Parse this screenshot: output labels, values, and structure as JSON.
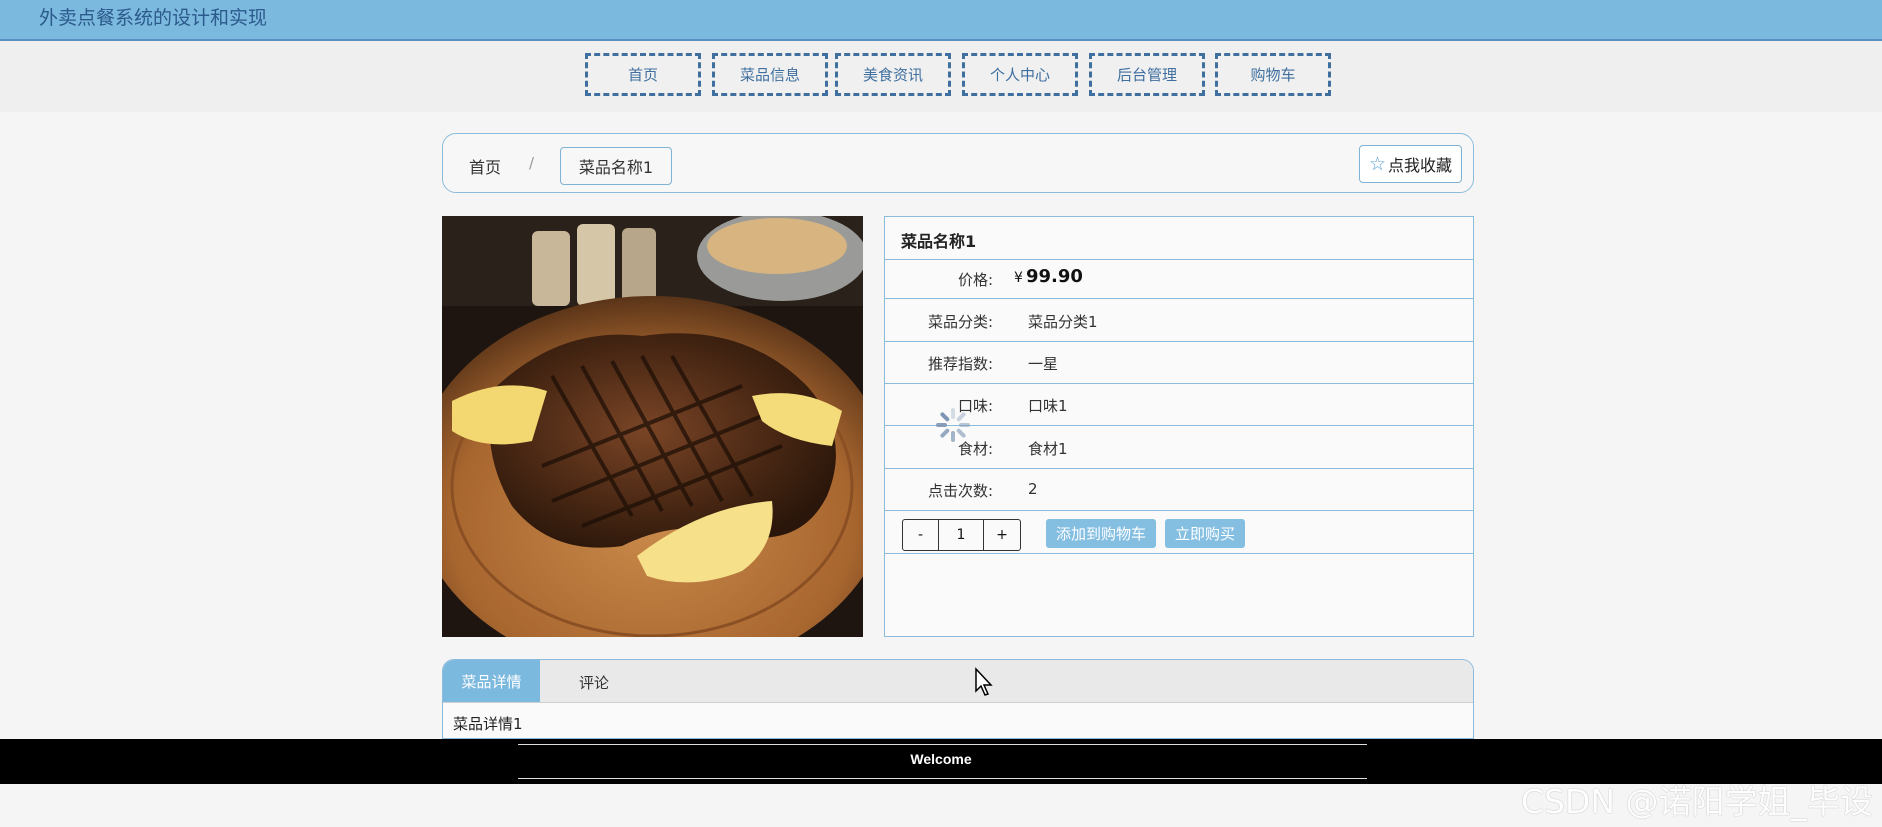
{
  "app_title": "外卖点餐系统的设计和实现",
  "nav": [
    "首页",
    "菜品信息",
    "美食资讯",
    "个人中心",
    "后台管理",
    "购物车"
  ],
  "breadcrumb": {
    "home": "首页",
    "separator": "/",
    "current": "菜品名称1"
  },
  "favorite_label": "点我收藏",
  "product": {
    "name": "菜品名称1",
    "price_label": "价格:",
    "price_currency": "¥",
    "price_value": "99.90",
    "fields": [
      {
        "label": "菜品分类:",
        "value": "菜品分类1"
      },
      {
        "label": "推荐指数:",
        "value": "一星"
      },
      {
        "label": "口味:",
        "value": "口味1"
      },
      {
        "label": "食材:",
        "value": "食材1"
      },
      {
        "label": "点击次数:",
        "value": "2"
      }
    ],
    "quantity": "1",
    "minus": "-",
    "plus": "+",
    "add_to_cart": "添加到购物车",
    "buy_now": "立即购买"
  },
  "tabs": {
    "details": "菜品详情",
    "comments": "评论",
    "details_content": "菜品详情1"
  },
  "footer": {
    "welcome": "Welcome"
  },
  "watermark": "CSDN @诺阳学姐_毕设",
  "colors": {
    "accent": "#7cb9de",
    "nav_border": "#3f6f9f",
    "footer": "#000000"
  }
}
